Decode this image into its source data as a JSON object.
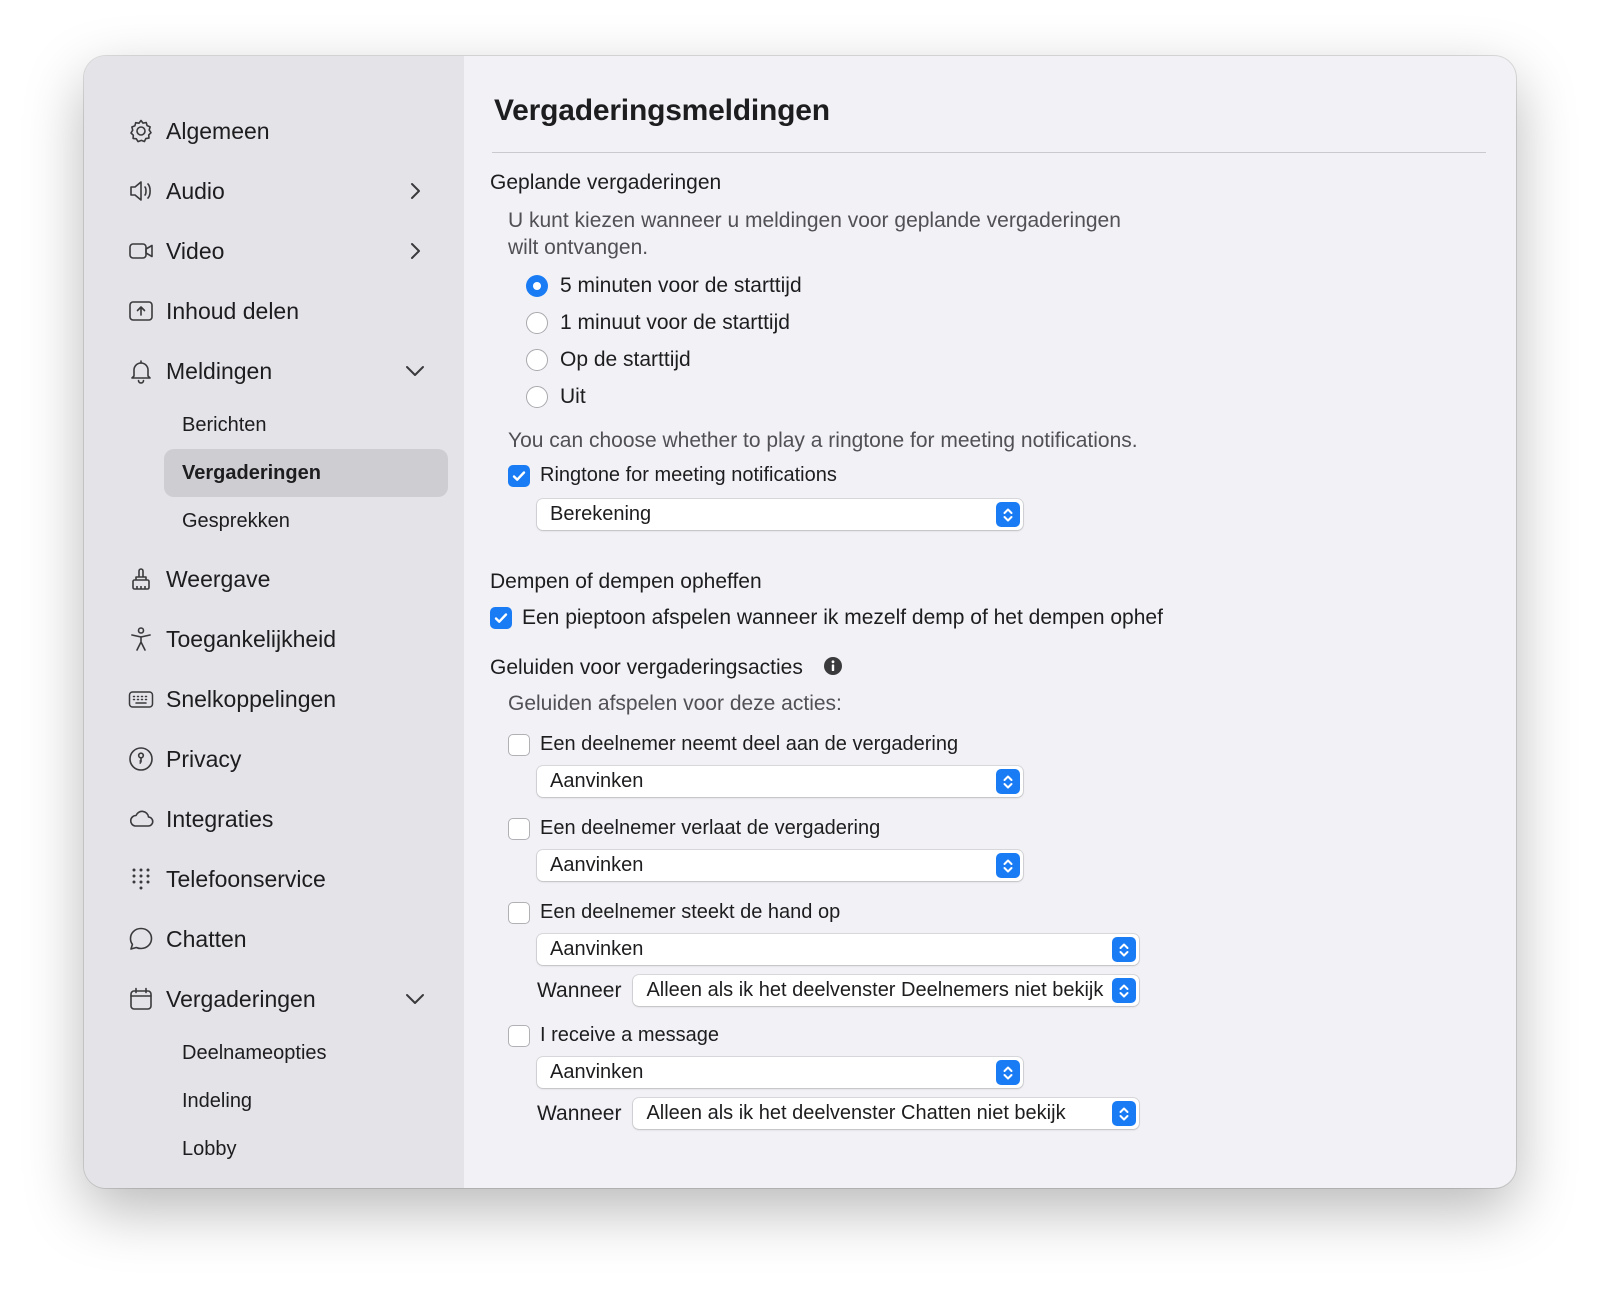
{
  "sidebar": {
    "items": [
      {
        "label": "Algemeen",
        "icon": "gear-icon"
      },
      {
        "label": "Audio",
        "icon": "speaker-icon"
      },
      {
        "label": "Video",
        "icon": "video-camera-icon"
      },
      {
        "label": "Inhoud delen",
        "icon": "share-screen-icon"
      },
      {
        "label": "Meldingen",
        "icon": "bell-icon"
      },
      {
        "label": "Weergave",
        "icon": "display-brush-icon"
      },
      {
        "label": "Toegankelijkheid",
        "icon": "accessibility-icon"
      },
      {
        "label": "Snelkoppelingen",
        "icon": "keyboard-icon"
      },
      {
        "label": "Privacy",
        "icon": "privacy-icon"
      },
      {
        "label": "Integraties",
        "icon": "cloud-icon"
      },
      {
        "label": "Telefoonservice",
        "icon": "dialpad-icon"
      },
      {
        "label": "Chatten",
        "icon": "chat-bubble-icon"
      },
      {
        "label": "Vergaderingen",
        "icon": "calendar-icon"
      }
    ],
    "meldingen_sub": [
      "Berichten",
      "Vergaderingen",
      "Gesprekken"
    ],
    "vergaderingen_sub": [
      "Deelnameopties",
      "Indeling",
      "Lobby"
    ],
    "selected_sub": "Vergaderingen"
  },
  "main": {
    "title": "Vergaderingsmeldingen",
    "scheduled": {
      "title": "Geplande vergaderingen",
      "desc_line1": "U kunt kiezen wanneer u meldingen voor geplande vergaderingen",
      "desc_line2": "wilt ontvangen.",
      "options": [
        "5 minuten voor de starttijd",
        "1 minuut voor de starttijd",
        "Op de starttijd",
        "Uit"
      ],
      "selected_index": 0,
      "ringtone_desc": "You can choose whether to play a ringtone for meeting notifications.",
      "ringtone_check_label": "Ringtone for meeting notifications",
      "ringtone_checked": true,
      "ringtone_value": "Berekening"
    },
    "mute": {
      "title": "Dempen of dempen opheffen",
      "check_label": "Een pieptoon afspelen wanneer ik mezelf demp of het dempen ophef",
      "checked": true
    },
    "sounds": {
      "title": "Geluiden voor vergaderingsacties",
      "desc": "Geluiden afspelen voor deze acties:",
      "join_label": "Een deelnemer neemt deel aan de vergadering",
      "join_value": "Aanvinken",
      "leave_label": "Een deelnemer verlaat de vergadering",
      "leave_value": "Aanvinken",
      "hand_label": "Een deelnemer steekt de hand op",
      "hand_value": "Aanvinken",
      "hand_when_label": "Wanneer",
      "hand_when_value": "Alleen als ik het deelvenster Deelnemers niet bekijk",
      "message_label": "I receive a message",
      "message_value": "Aanvinken",
      "message_when_label": "Wanneer",
      "message_when_value": "Alleen als ik het deelvenster Chatten niet bekijk"
    }
  },
  "colors": {
    "accent": "#1a7cf5",
    "sidebar_bg": "#e3e3e8",
    "main_bg": "#f2f2f6",
    "selected_bg": "#cdcdd2"
  }
}
